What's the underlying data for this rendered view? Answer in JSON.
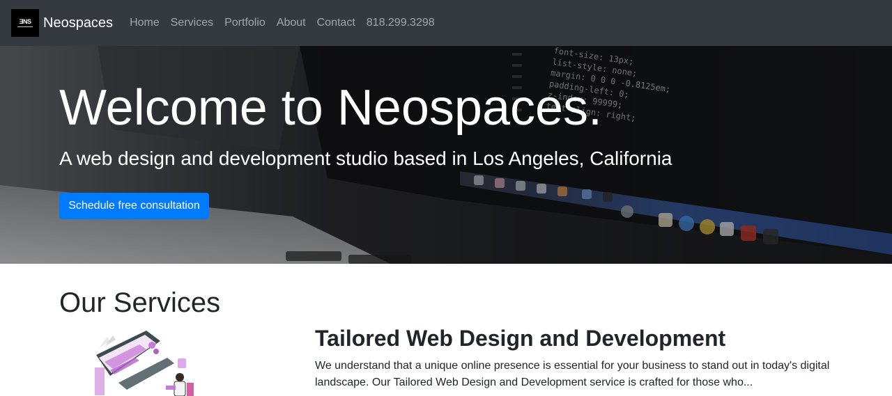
{
  "nav": {
    "logo_text": "ƎNS",
    "brand": "Neospaces",
    "links": [
      "Home",
      "Services",
      "Portfolio",
      "About",
      "Contact",
      "818.299.3298"
    ]
  },
  "hero": {
    "title": "Welcome to Neospaces.",
    "subtitle": "A web design and development studio based in Los Angeles, California",
    "cta_label": "Schedule free consultation"
  },
  "services": {
    "heading": "Our Services",
    "items": [
      {
        "title": "Tailored Web Design and Development",
        "description": "We understand that a unique online presence is essential for your business to stand out in today's digital landscape. Our Tailored Web Design and Development service is crafted for those who..."
      }
    ]
  },
  "code_lines": [
    "font-size: 13px;",
    "list-style: none;",
    "margin: 0 0 0 -0.8125em;",
    "padding-left: 0;",
    "z-index: 99999;",
    "text-align: right;"
  ],
  "colors": {
    "navbar": "#343a40",
    "primary": "#007bff",
    "hero_overlay": "#1c1d20"
  }
}
